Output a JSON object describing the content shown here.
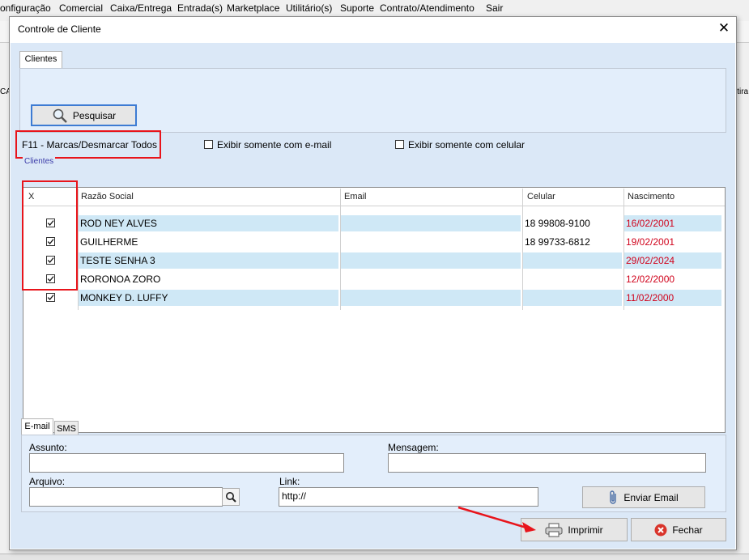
{
  "menu": [
    "onfiguração",
    "Comercial",
    "Caixa/Entrega",
    "Entrada(s)",
    "Marketplace",
    "Utilitário(s)",
    "Suporte",
    "Contrato/Atendimento",
    "Sair"
  ],
  "background": {
    "left_text": "CA",
    "right_text": "itira"
  },
  "dialog": {
    "title": "Controle de Cliente"
  },
  "tabs": {
    "clientes": "Clientes",
    "email": "E-mail",
    "sms": "SMS"
  },
  "search_button": "Pesquisar",
  "f11_label": "F11 - Marcas/Desmarcar Todos",
  "filters": {
    "email_only": "Exibir somente com e-mail",
    "cell_only": "Exibir somente com celular"
  },
  "group_label": "Clientes",
  "columns": [
    "X",
    "Razão Social",
    "Email",
    "Celular",
    "Nascimento"
  ],
  "rows": [
    {
      "checked": true,
      "name": "ROD NEY ALVES",
      "email": "",
      "phone": "18 99808-9100",
      "birth": "16/02/2001"
    },
    {
      "checked": true,
      "name": "GUILHERME",
      "email": "",
      "phone": "18 99733-6812",
      "birth": "19/02/2001"
    },
    {
      "checked": true,
      "name": "TESTE SENHA 3",
      "email": "",
      "phone": "",
      "birth": "29/02/2024"
    },
    {
      "checked": true,
      "name": "RORONOA ZORO",
      "email": "",
      "phone": "",
      "birth": "12/02/2000"
    },
    {
      "checked": true,
      "name": "MONKEY D. LUFFY",
      "email": "",
      "phone": "",
      "birth": "11/02/2000"
    }
  ],
  "form": {
    "assunto_label": "Assunto:",
    "assunto_value": "",
    "mensagem_label": "Mensagem:",
    "mensagem_value": "",
    "arquivo_label": "Arquivo:",
    "arquivo_value": "",
    "link_label": "Link:",
    "link_value": "http://"
  },
  "buttons": {
    "send_email": "Enviar Email",
    "print": "Imprimir",
    "close": "Fechar"
  },
  "colors": {
    "highlight": "#e8141b",
    "row_blue": "#cfe8f6",
    "date_red": "#d0021b"
  }
}
